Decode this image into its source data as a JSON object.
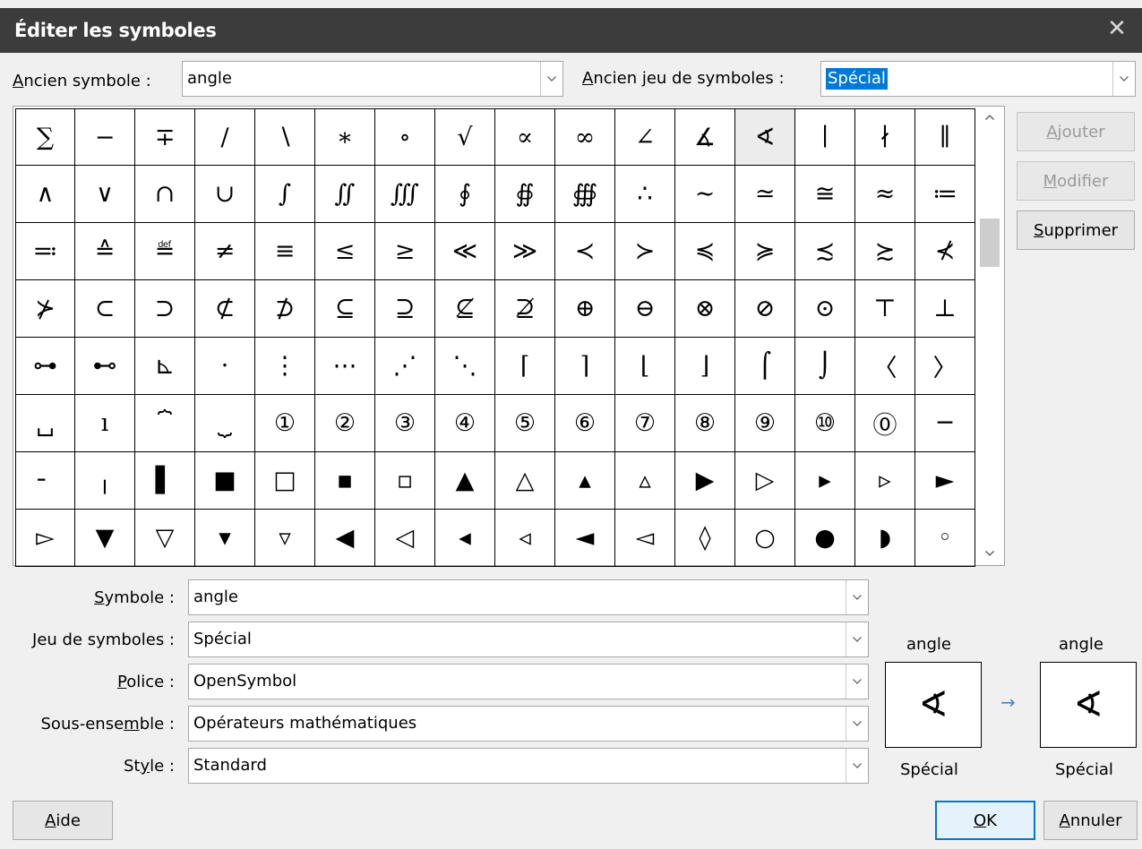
{
  "window": {
    "title": "Éditer les symboles",
    "close_glyph": "✕"
  },
  "old_symbol": {
    "label_pre": "",
    "label_mnemonic": "A",
    "label_post": "ncien symbole :",
    "value": "angle"
  },
  "old_set": {
    "label_mnemonic": "A",
    "label_post": "ncien jeu de symboles :",
    "value": "Spécial"
  },
  "symbols": {
    "rows": [
      [
        "∑",
        "−",
        "∓",
        "∕",
        "∖",
        "∗",
        "∘",
        "√",
        "∝",
        "∞",
        "∠",
        "∡",
        "∢",
        "∣",
        "∤",
        "∥"
      ],
      [
        "∧",
        "∨",
        "∩",
        "∪",
        "∫",
        "∬",
        "∭",
        "∮",
        "∯",
        "∰",
        "∴",
        "∼",
        "≃",
        "≅",
        "≈",
        "≔"
      ],
      [
        "≕",
        "≙",
        "≝",
        "≠",
        "≡",
        "≤",
        "≥",
        "≪",
        "≫",
        "≺",
        "≻",
        "≼",
        "≽",
        "≾",
        "≿",
        "⊀"
      ],
      [
        "⊁",
        "⊂",
        "⊃",
        "⊄",
        "⊅",
        "⊆",
        "⊇",
        "⊈",
        "⊉",
        "⊕",
        "⊖",
        "⊗",
        "⊘",
        "⊙",
        "⊤",
        "⊥"
      ],
      [
        "⊶",
        "⊷",
        "⊾",
        "⋅",
        "⋮",
        "⋯",
        "⋰",
        "⋱",
        "⌈",
        "⌉",
        "⌊",
        "⌋",
        "⌠",
        "⌡",
        "〈",
        "〉"
      ],
      [
        "␣",
        "ı",
        "⏞",
        "⏟",
        "①",
        "②",
        "③",
        "④",
        "⑤",
        "⑥",
        "⑦",
        "⑧",
        "⑨",
        "⑩",
        "⓪",
        "─"
      ],
      [
        "╴",
        "╷",
        "▌",
        "■",
        "□",
        "▪",
        "▫",
        "▲",
        "△",
        "▴",
        "▵",
        "▶",
        "▷",
        "▸",
        "▹",
        "►"
      ],
      [
        "▻",
        "▼",
        "▽",
        "▾",
        "▿",
        "◀",
        "◁",
        "◂",
        "◃",
        "◄",
        "◅",
        "◊",
        "○",
        "●",
        "◗",
        "◦"
      ]
    ],
    "selected_row": 0,
    "selected_col": 12,
    "scroll_up_glyph": "▲",
    "scroll_down_glyph": "▼"
  },
  "buttons": {
    "add": {
      "mnemonic": "A",
      "rest": "jouter"
    },
    "modify": {
      "mnemonic": "M",
      "rest": "odifier"
    },
    "delete": {
      "mnemonic": "S",
      "rest": "upprimer"
    },
    "help": {
      "mnemonic": "A",
      "rest": "ide"
    },
    "ok": {
      "mnemonic": "O",
      "rest": "K"
    },
    "cancel": {
      "mnemonic": "A",
      "rest": "nnuler"
    }
  },
  "fields": {
    "symbol": {
      "pre": "",
      "mnemonic": "S",
      "post": "ymbole :",
      "value": "angle"
    },
    "set": {
      "pre": "",
      "mnemonic": "J",
      "post": "eu de symboles :",
      "value": "Spécial"
    },
    "font": {
      "pre": "",
      "mnemonic": "P",
      "post": "olice :",
      "value": "OpenSymbol"
    },
    "subset": {
      "pre": "Sous-ense",
      "mnemonic": "m",
      "post": "ble :",
      "value": "Opérateurs mathématiques"
    },
    "style": {
      "pre": "St",
      "mnemonic": "y",
      "post": "le :",
      "value": "Standard"
    }
  },
  "preview": {
    "old_name": "angle",
    "old_glyph": "∢",
    "old_set": "Spécial",
    "new_name": "angle",
    "new_glyph": "∢",
    "new_set": "Spécial",
    "arrow": "→"
  }
}
